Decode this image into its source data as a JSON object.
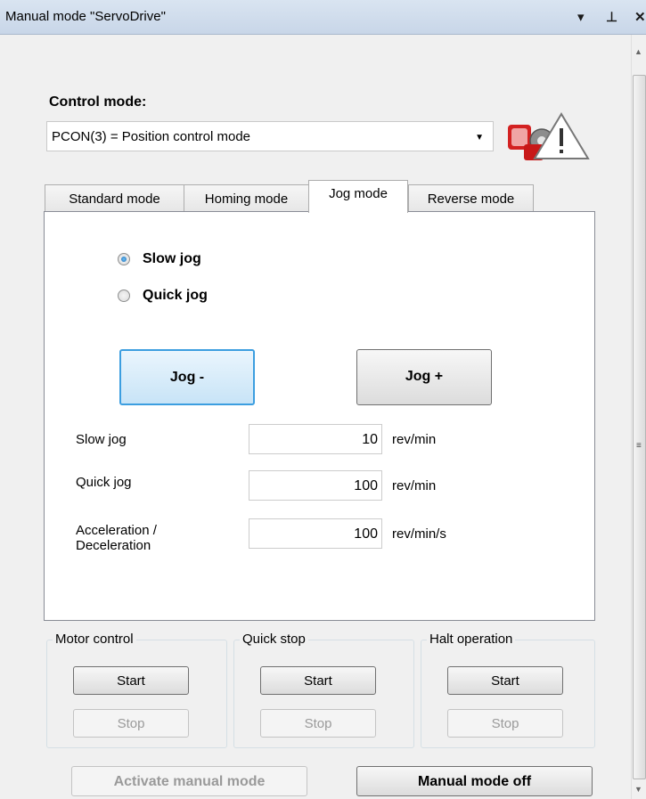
{
  "window": {
    "title": "Manual mode \"ServoDrive\"",
    "dropdown_glyph": "▾",
    "pin_glyph": "ᵖ",
    "close_glyph": "✕"
  },
  "control_mode": {
    "label": "Control mode:",
    "selected": "PCON(3) = Position control mode",
    "arrow": "▼",
    "icon": "servo-warning-icon"
  },
  "tabs": [
    {
      "label": "Standard mode",
      "active": false
    },
    {
      "label": "Homing mode",
      "active": false
    },
    {
      "label": "Jog mode",
      "active": true
    },
    {
      "label": "Reverse mode",
      "active": false
    }
  ],
  "jog": {
    "radios": [
      {
        "label": "Slow jog",
        "checked": true
      },
      {
        "label": "Quick jog",
        "checked": false
      }
    ],
    "jog_minus": "Jog -",
    "jog_plus": "Jog +",
    "params": [
      {
        "label": "Slow jog",
        "value": "10",
        "unit": "rev/min"
      },
      {
        "label": "Quick jog",
        "value": "100",
        "unit": "rev/min"
      },
      {
        "label": "Acceleration /\nDeceleration",
        "value": "100",
        "unit": "rev/min/s"
      }
    ]
  },
  "groups": [
    {
      "title": "Motor control",
      "start": "Start",
      "stop": "Stop"
    },
    {
      "title": "Quick stop",
      "start": "Start",
      "stop": "Stop"
    },
    {
      "title": "Halt operation",
      "start": "Start",
      "stop": "Stop"
    }
  ],
  "footer": {
    "activate": "Activate manual mode",
    "off": "Manual mode off"
  },
  "colors": {
    "title_bar": "#c8d6e8",
    "focus_border": "#3c9ee0",
    "radio_checked": "#1e6bb5"
  }
}
